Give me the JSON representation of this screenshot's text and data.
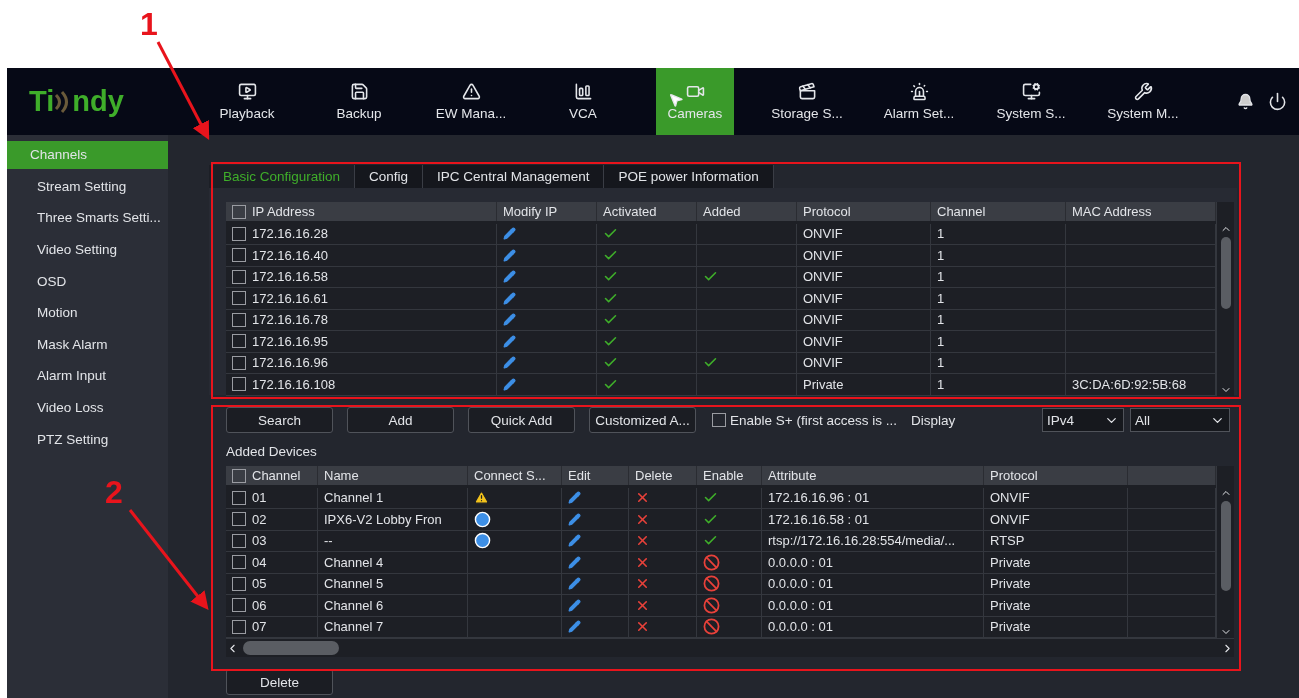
{
  "logo": {
    "text_start": "Ti",
    "text_end": "ndy"
  },
  "nav": [
    {
      "label": "Playback",
      "selected": false
    },
    {
      "label": "Backup",
      "selected": false
    },
    {
      "label": "EW Mana...",
      "selected": false
    },
    {
      "label": "VCA",
      "selected": false
    },
    {
      "label": "Cameras",
      "selected": true
    },
    {
      "label": "Storage S...",
      "selected": false
    },
    {
      "label": "Alarm Set...",
      "selected": false
    },
    {
      "label": "System S...",
      "selected": false
    },
    {
      "label": "System M...",
      "selected": false
    }
  ],
  "sidebar": {
    "items": [
      {
        "label": "Channels",
        "selected": true
      },
      {
        "label": "Stream Setting",
        "selected": false
      },
      {
        "label": "Three Smarts Setti...",
        "selected": false
      },
      {
        "label": "Video Setting",
        "selected": false
      },
      {
        "label": "OSD",
        "selected": false
      },
      {
        "label": "Motion",
        "selected": false
      },
      {
        "label": "Mask Alarm",
        "selected": false
      },
      {
        "label": "Alarm Input",
        "selected": false
      },
      {
        "label": "Video Loss",
        "selected": false
      },
      {
        "label": "PTZ Setting",
        "selected": false
      }
    ]
  },
  "tabs": [
    {
      "label": "Basic Configuration",
      "selected": true
    },
    {
      "label": "Config",
      "selected": false
    },
    {
      "label": "IPC Central Management",
      "selected": false
    },
    {
      "label": "POE power Information",
      "selected": false
    }
  ],
  "search_table": {
    "select_all_checked": false,
    "columns": [
      "IP Address",
      "Modify IP",
      "Activated",
      "Added",
      "Protocol",
      "Channel",
      "MAC Address"
    ],
    "rows": [
      {
        "checked": false,
        "ip": "172.16.16.28",
        "activated": true,
        "added": false,
        "protocol": "ONVIF",
        "channel": "1"
      },
      {
        "checked": false,
        "ip": "172.16.16.40",
        "activated": true,
        "added": false,
        "protocol": "ONVIF",
        "channel": "1"
      },
      {
        "checked": false,
        "ip": "172.16.16.58",
        "activated": true,
        "added": true,
        "protocol": "ONVIF",
        "channel": "1"
      },
      {
        "checked": false,
        "ip": "172.16.16.61",
        "activated": true,
        "added": false,
        "protocol": "ONVIF",
        "channel": "1"
      },
      {
        "checked": false,
        "ip": "172.16.16.78",
        "activated": true,
        "added": false,
        "protocol": "ONVIF",
        "channel": "1"
      },
      {
        "checked": false,
        "ip": "172.16.16.95",
        "activated": true,
        "added": false,
        "protocol": "ONVIF",
        "channel": "1"
      },
      {
        "checked": false,
        "ip": "172.16.16.96",
        "activated": true,
        "added": true,
        "protocol": "ONVIF",
        "channel": "1"
      },
      {
        "checked": false,
        "ip": "172.16.16.108",
        "activated": true,
        "added": false,
        "protocol": "Private",
        "channel": "1",
        "mac": "3C:DA:6D:92:5B:68"
      }
    ]
  },
  "toolbar": {
    "buttons": [
      "Search",
      "Add",
      "Quick Add",
      "Customized A..."
    ],
    "enable_s_plus": {
      "label": "Enable S+ (first access is ...",
      "checked": false
    },
    "display_label": "Display",
    "selects": [
      "IPv4",
      "All"
    ]
  },
  "added_devices": {
    "title": "Added Devices",
    "select_all_checked": false,
    "columns": [
      "Channel",
      "Name",
      "Connect S...",
      "Edit",
      "Delete",
      "Enable",
      "Attribute",
      "Protocol"
    ],
    "rows": [
      {
        "checked": false,
        "channel": "01",
        "name": "Channel 1",
        "kind": "warning",
        "enabled": true,
        "attribute": "172.16.16.96 : 01",
        "protocol": "ONVIF"
      },
      {
        "checked": false,
        "channel": "02",
        "name": "IPX6-V2 Lobby Fron",
        "kind": "online",
        "enabled": true,
        "attribute": "172.16.16.58 : 01",
        "protocol": "ONVIF"
      },
      {
        "checked": false,
        "channel": "03",
        "name": "--",
        "kind": "online",
        "enabled": true,
        "attribute": "rtsp://172.16.16.28:554/media/...",
        "protocol": "RTSP"
      },
      {
        "checked": false,
        "channel": "04",
        "name": "Channel 4",
        "kind": "idle",
        "enabled": false,
        "attribute": "0.0.0.0 : 01",
        "protocol": "Private"
      },
      {
        "checked": false,
        "channel": "05",
        "name": "Channel 5",
        "kind": "idle",
        "enabled": false,
        "attribute": "0.0.0.0 : 01",
        "protocol": "Private"
      },
      {
        "checked": false,
        "channel": "06",
        "name": "Channel 6",
        "kind": "idle",
        "enabled": false,
        "attribute": "0.0.0.0 : 01",
        "protocol": "Private"
      },
      {
        "checked": false,
        "channel": "07",
        "name": "Channel 7",
        "kind": "idle",
        "enabled": false,
        "attribute": "0.0.0.0 : 01",
        "protocol": "Private"
      }
    ]
  },
  "delete_button": "Delete",
  "annotations": [
    {
      "number": "1"
    },
    {
      "number": "2"
    }
  ]
}
